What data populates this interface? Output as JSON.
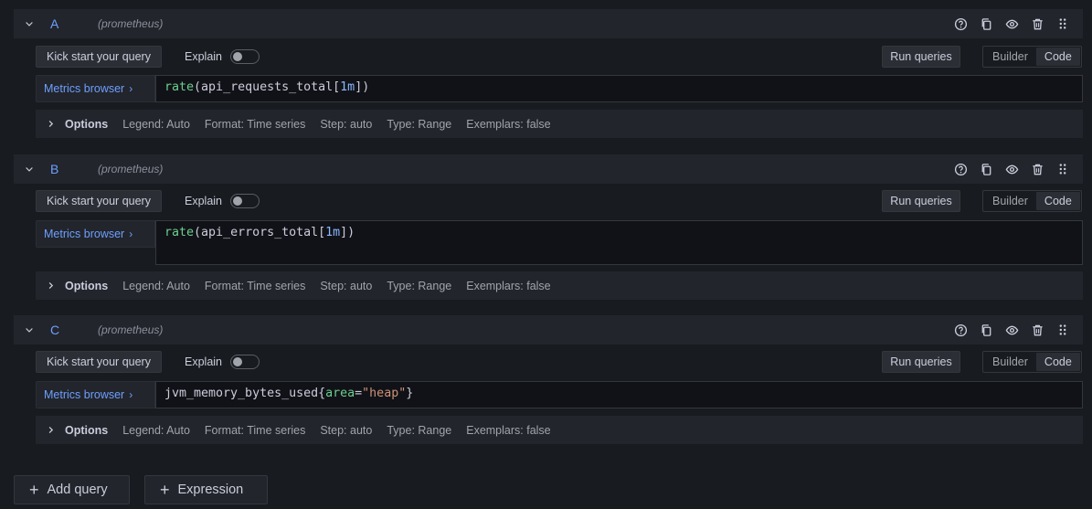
{
  "queries": [
    {
      "ref_id": "A",
      "datasource": "(prometheus)",
      "kick_start": "Kick start your query",
      "explain": "Explain",
      "run_queries": "Run queries",
      "mode_builder": "Builder",
      "mode_code": "Code",
      "metrics_browser": "Metrics browser",
      "expr_tokens": [
        "rate",
        "(",
        "api_requests_total",
        "[",
        "1m",
        "])"
      ],
      "options": {
        "title": "Options",
        "legend": "Legend: Auto",
        "format": "Format: Time series",
        "step": "Step: auto",
        "type": "Type: Range",
        "exemplars": "Exemplars: false"
      }
    },
    {
      "ref_id": "B",
      "datasource": "(prometheus)",
      "kick_start": "Kick start your query",
      "explain": "Explain",
      "run_queries": "Run queries",
      "mode_builder": "Builder",
      "mode_code": "Code",
      "metrics_browser": "Metrics browser",
      "expr_tokens": [
        "rate",
        "(",
        "api_errors_total",
        "[",
        "1m",
        "])"
      ],
      "options": {
        "title": "Options",
        "legend": "Legend: Auto",
        "format": "Format: Time series",
        "step": "Step: auto",
        "type": "Type: Range",
        "exemplars": "Exemplars: false"
      }
    },
    {
      "ref_id": "C",
      "datasource": "(prometheus)",
      "kick_start": "Kick start your query",
      "explain": "Explain",
      "run_queries": "Run queries",
      "mode_builder": "Builder",
      "mode_code": "Code",
      "metrics_browser": "Metrics browser",
      "expr_tokens": [
        "jvm_memory_bytes_used{",
        "area",
        "=",
        "\"heap\"",
        "}"
      ],
      "options": {
        "title": "Options",
        "legend": "Legend: Auto",
        "format": "Format: Time series",
        "step": "Step: auto",
        "type": "Type: Range",
        "exemplars": "Exemplars: false"
      }
    }
  ],
  "actions": {
    "add_query": "Add query",
    "expression": "Expression"
  },
  "icons": {
    "collapse": "chevron-down-icon",
    "help": "question-circle-icon",
    "duplicate": "copy-icon",
    "toggle_visibility": "eye-icon",
    "remove": "trash-icon",
    "drag": "drag-handle-icon",
    "expand_options": "chevron-right-icon"
  },
  "colors": {
    "ref_id": "#6e9fff",
    "function": "#6ccf8e",
    "number": "#8ab8ff",
    "string": "#ce9178"
  }
}
